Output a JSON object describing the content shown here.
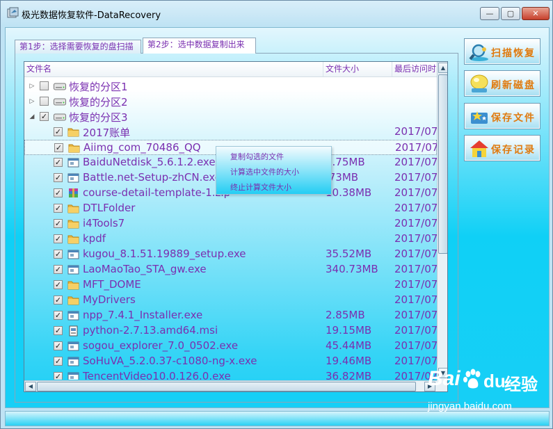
{
  "window": {
    "title": "极光数据恢复软件-DataRecovery",
    "controls": {
      "minimize": "—",
      "maximize": "▢",
      "close": "✕"
    }
  },
  "tabs": [
    {
      "label": "第1步：选择需要恢复的盘扫描",
      "active": false
    },
    {
      "label": "第2步：选中数据复制出来",
      "active": true
    }
  ],
  "columns": {
    "name": "文件名",
    "size": "文件大小",
    "date": "最后访问时"
  },
  "rows": [
    {
      "level": 0,
      "expander": "▷",
      "checked": false,
      "icon": "drive-icon",
      "name": "恢复的分区1",
      "size": "",
      "date": ""
    },
    {
      "level": 0,
      "expander": "▷",
      "checked": false,
      "icon": "drive-icon",
      "name": "恢复的分区2",
      "size": "",
      "date": ""
    },
    {
      "level": 0,
      "expander": "◢",
      "checked": true,
      "icon": "drive-icon",
      "name": "恢复的分区3",
      "size": "",
      "date": ""
    },
    {
      "level": 1,
      "checked": true,
      "icon": "folder-icon",
      "name": "2017账单",
      "size": "",
      "date": "2017/07"
    },
    {
      "level": 1,
      "checked": true,
      "icon": "folder-icon",
      "name": "Aiimg_com_70486_QQ",
      "size": "",
      "date": "2017/07",
      "selected": true
    },
    {
      "level": 1,
      "checked": true,
      "icon": "exe-icon",
      "name": "BaiduNetdisk_5.6.1.2.exe",
      "size": "1.75MB",
      "date": "2017/07"
    },
    {
      "level": 1,
      "checked": true,
      "icon": "exe-icon",
      "name": "Battle.net-Setup-zhCN.exe",
      "size": ".73MB",
      "date": "2017/07"
    },
    {
      "level": 1,
      "checked": true,
      "icon": "archive-icon",
      "name": "course-detail-template-1.zip",
      "size": "10.38MB",
      "date": "2017/07"
    },
    {
      "level": 1,
      "checked": true,
      "icon": "folder-icon",
      "name": "DTLFolder",
      "size": "",
      "date": "2017/07"
    },
    {
      "level": 1,
      "checked": true,
      "icon": "folder-icon",
      "name": "i4Tools7",
      "size": "",
      "date": "2017/07"
    },
    {
      "level": 1,
      "checked": true,
      "icon": "folder-icon",
      "name": "kpdf",
      "size": "",
      "date": "2017/07"
    },
    {
      "level": 1,
      "checked": true,
      "icon": "exe-icon",
      "name": "kugou_8.1.51.19889_setup.exe",
      "size": "35.52MB",
      "date": "2017/07"
    },
    {
      "level": 1,
      "checked": true,
      "icon": "exe-icon",
      "name": "LaoMaoTao_STA_gw.exe",
      "size": "340.73MB",
      "date": "2017/07"
    },
    {
      "level": 1,
      "checked": true,
      "icon": "folder-icon",
      "name": "MFT_DOME",
      "size": "",
      "date": "2017/07"
    },
    {
      "level": 1,
      "checked": true,
      "icon": "folder-icon",
      "name": "MyDrivers",
      "size": "",
      "date": "2017/07"
    },
    {
      "level": 1,
      "checked": true,
      "icon": "exe-icon",
      "name": "npp_7.4.1_Installer.exe",
      "size": "2.85MB",
      "date": "2017/07"
    },
    {
      "level": 1,
      "checked": true,
      "icon": "msi-icon",
      "name": "python-2.7.13.amd64.msi",
      "size": "19.15MB",
      "date": "2017/07"
    },
    {
      "level": 1,
      "checked": true,
      "icon": "exe-icon",
      "name": "sogou_explorer_7.0_0502.exe",
      "size": "45.44MB",
      "date": "2017/07"
    },
    {
      "level": 1,
      "checked": true,
      "icon": "exe-icon",
      "name": "SoHuVA_5.2.0.37-c1080-ng-x.exe",
      "size": "19.46MB",
      "date": "2017/07"
    },
    {
      "level": 1,
      "checked": true,
      "icon": "exe-icon",
      "name": "TencentVideo10.0.126.0.exe",
      "size": "36.82MB",
      "date": "2017/07"
    }
  ],
  "context_menu": [
    "复制勾选的文件",
    "计算选中文件的大小",
    "终止计算文件大小"
  ],
  "side_buttons": [
    {
      "label": "扫描恢复",
      "icon": "magnifier-icon"
    },
    {
      "label": "刷新磁盘",
      "icon": "bulb-icon"
    },
    {
      "label": "保存文件",
      "icon": "star-folder-icon"
    },
    {
      "label": "保存记录",
      "icon": "house-icon"
    }
  ],
  "watermark": {
    "brand": "Bai",
    "brand2": "du",
    "suffix": "经验",
    "url": "jingyan.baidu.com"
  }
}
